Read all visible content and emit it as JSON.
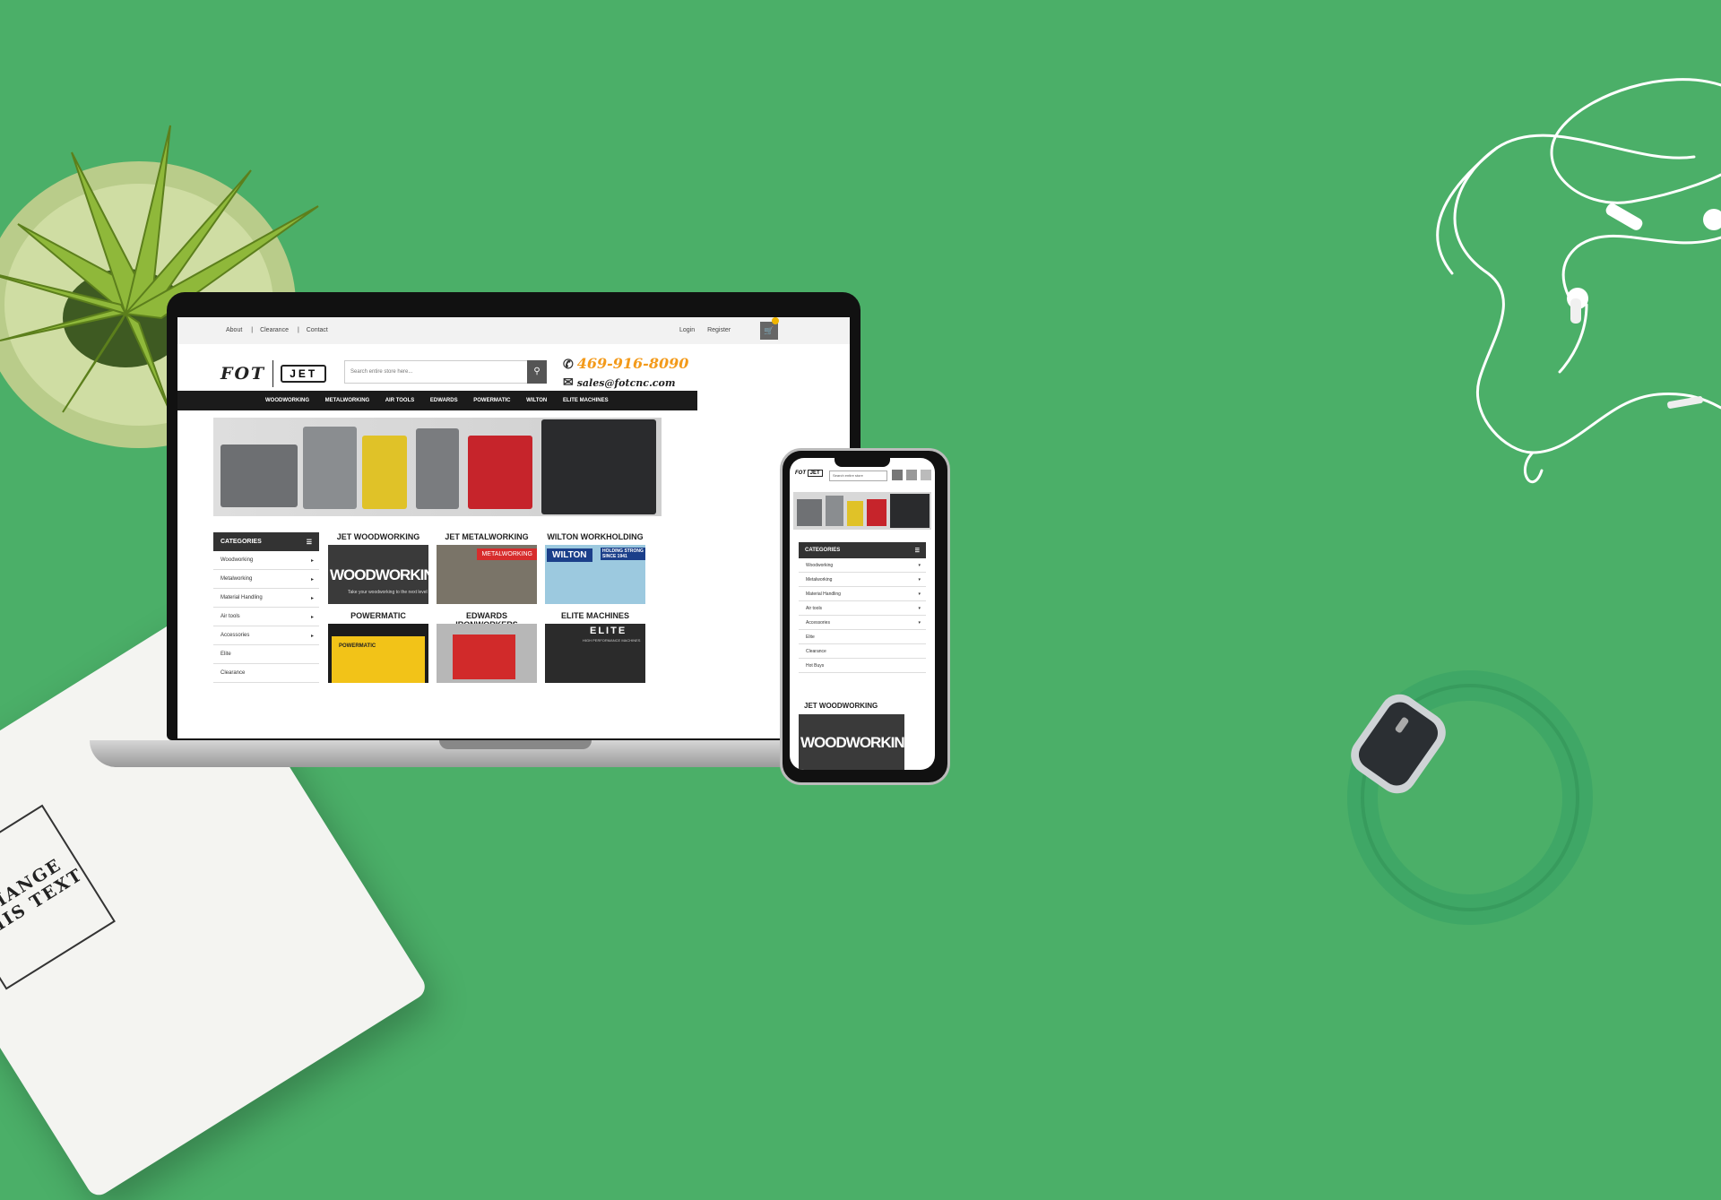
{
  "notebook": {
    "stamp_lines": [
      "CHANGE",
      "THIS TEXT"
    ]
  },
  "site": {
    "top_links": [
      "About",
      "Clearance",
      "Contact"
    ],
    "auth": [
      "Login",
      "Register"
    ],
    "logo": {
      "left": "FOT",
      "right": "JET"
    },
    "search_placeholder": "Search entire store here...",
    "phone": "469-916-8090",
    "email": "sales@fotcnc.com",
    "nav": [
      "WOODWORKING",
      "METALWORKING",
      "AIR TOOLS",
      "EDWARDS",
      "POWERMATIC",
      "WILTON",
      "ELITE MACHINES"
    ],
    "categories_title": "CATEGORIES",
    "categories": [
      "Woodworking",
      "Metalworking",
      "Material Handling",
      "Air tools",
      "Accessories",
      "Elite",
      "Clearance"
    ],
    "tiles": [
      {
        "title": "JET WOODWORKING",
        "img_text": "WOODWORKING",
        "sub": "Take your woodworking to the next level"
      },
      {
        "title": "JET METALWORKING",
        "img_text": "METALWORKING"
      },
      {
        "title": "WILTON WORKHOLDING",
        "img_text": "WILTON",
        "badge": "HOLDING STRONG SINCE 1941"
      },
      {
        "title": "POWERMATIC",
        "img_text": "POWERMATIC"
      },
      {
        "title": "EDWARDS IRONWORKERS",
        "img_text": ""
      },
      {
        "title": "ELITE MACHINES",
        "img_text": "ELITE",
        "sub": "HIGH PERFORMANCE MACHINES"
      }
    ]
  },
  "mobile": {
    "search_placeholder": "Search entire store",
    "categories_title": "CATEGORIES",
    "categories": [
      "Woodworking",
      "Metalworking",
      "Material Handling",
      "Air tools",
      "Accessories",
      "Elite",
      "Clearance",
      "Hot Buys"
    ],
    "tile_title": "JET WOODWORKING",
    "tile_img_text": "WOODWORKING"
  }
}
